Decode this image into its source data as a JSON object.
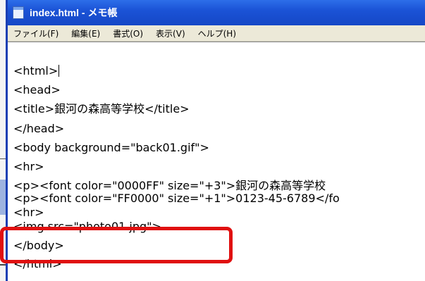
{
  "window": {
    "title": "index.html - メモ帳"
  },
  "menu": {
    "items": [
      "ファイル(F)",
      "編集(E)",
      "書式(O)",
      "表示(V)",
      "ヘルプ(H)"
    ]
  },
  "editor": {
    "lines": [
      "<html>",
      "<head>",
      "<title>銀河の森高等学校</title>",
      "</head>",
      "<body background=\"back01.gif\">",
      "<hr>",
      "<p><font color=\"0000FF\" size=\"+3\">銀河の森高等学校",
      "<p><font color=\"FF0000\" size=\"+1\">0123-45-6789</fo",
      "<hr>",
      "<img src=\"photo01.jpg\">",
      "</body>",
      "</html>"
    ]
  },
  "colors": {
    "titlebar": "#1b53d6",
    "highlight": "#e01010"
  }
}
